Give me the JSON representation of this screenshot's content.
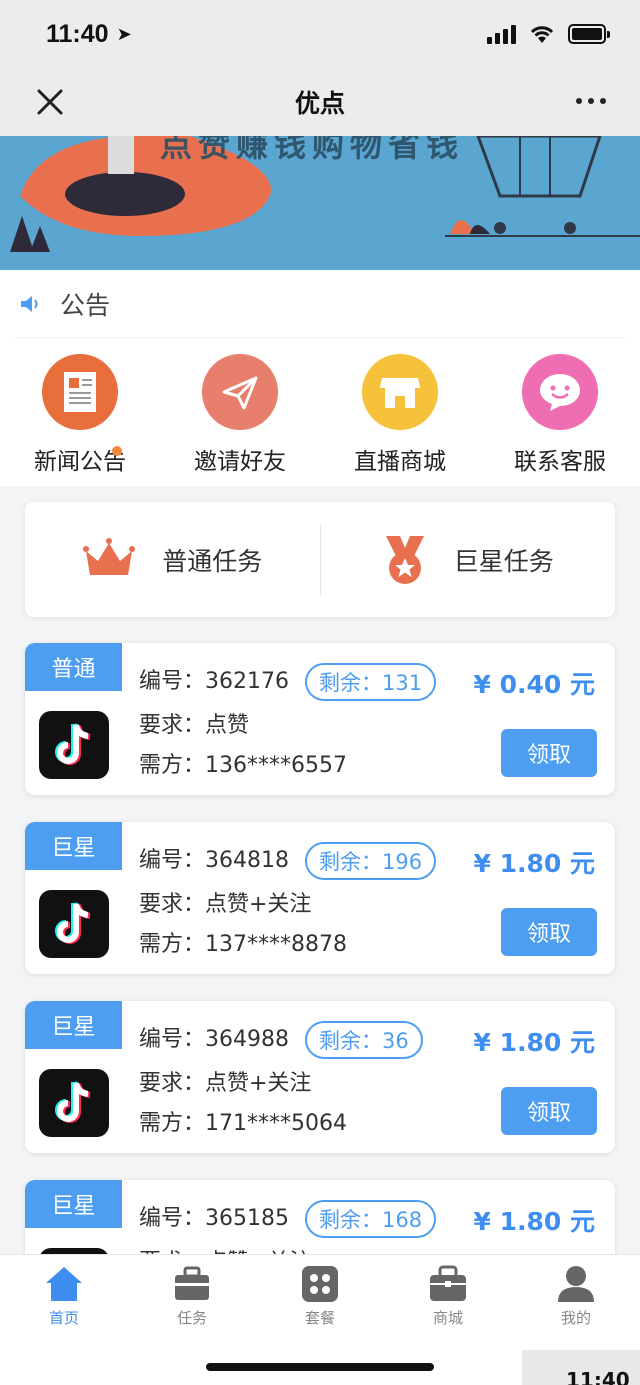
{
  "status_bar": {
    "time": "11:40"
  },
  "nav": {
    "title": "优点"
  },
  "banner": {
    "text": "点赞赚钱购物省钱"
  },
  "notice": {
    "label": "公告"
  },
  "menu": [
    {
      "label": "新闻公告",
      "icon": "news-icon",
      "color": "#e86f3c"
    },
    {
      "label": "邀请好友",
      "icon": "paper-plane-icon",
      "color": "#e87e6c"
    },
    {
      "label": "直播商城",
      "icon": "store-icon",
      "color": "#f6c23b"
    },
    {
      "label": "联系客服",
      "icon": "smile-chat-icon",
      "color": "#ef6db2"
    }
  ],
  "task_types": [
    {
      "label": "普通任务",
      "icon": "crown-icon"
    },
    {
      "label": "巨星任务",
      "icon": "medal-icon"
    }
  ],
  "tasks": [
    {
      "tag": "普通",
      "number": "编号：362176",
      "remain": "剩余：131",
      "price": "¥ 0.40 元",
      "requirement": "要求：点赞",
      "buyer": "需方：136****6557",
      "button": "领取"
    },
    {
      "tag": "巨星",
      "number": "编号：364818",
      "remain": "剩余：196",
      "price": "¥ 1.80 元",
      "requirement": "要求：点赞+关注",
      "buyer": "需方：137****8878",
      "button": "领取"
    },
    {
      "tag": "巨星",
      "number": "编号：364988",
      "remain": "剩余：36",
      "price": "¥ 1.80 元",
      "requirement": "要求：点赞+关注",
      "buyer": "需方：171****5064",
      "button": "领取"
    },
    {
      "tag": "巨星",
      "number": "编号：365185",
      "remain": "剩余：168",
      "price": "¥ 1.80 元",
      "requirement": "要求：点赞+关注",
      "buyer": "",
      "button": ""
    }
  ],
  "tabs": [
    {
      "label": "首页",
      "icon": "home-icon",
      "active": true
    },
    {
      "label": "任务",
      "icon": "briefcase-icon",
      "active": false
    },
    {
      "label": "套餐",
      "icon": "grid-icon",
      "active": false
    },
    {
      "label": "商城",
      "icon": "shop-bag-icon",
      "active": false
    },
    {
      "label": "我的",
      "icon": "user-icon",
      "active": false
    }
  ],
  "colors": {
    "accent": "#4d9ef0",
    "price": "#3d8ef0"
  }
}
